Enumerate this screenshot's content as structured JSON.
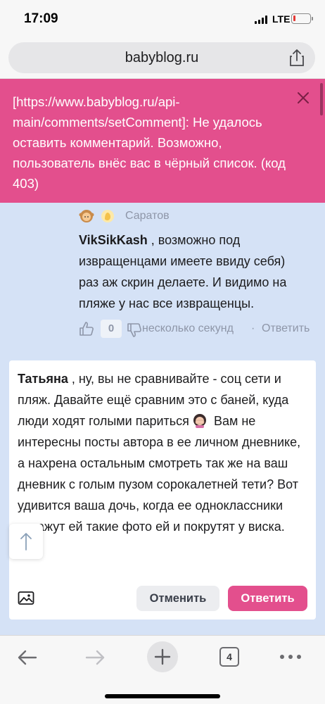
{
  "status_bar": {
    "time": "17:09",
    "network": "LTE",
    "battery_level": 0.15,
    "battery_color": "#e53935"
  },
  "browser": {
    "url": "babyblog.ru",
    "tab_count": "4"
  },
  "error_toast": {
    "message": "[https://www.babyblog.ru/api-main/comments/setComment]: Не удалось оставить комментарий. Возможно, пользователь внёс вас в чёрный список. (код 403)",
    "color": "#e34f8d"
  },
  "comment": {
    "city": "Саратов",
    "reply_to": "VikSikKash",
    "text": " , возможно под извращенцами имеете ввиду себя) раз аж скрин делаете. И видимо на пляже у нас все извращенцы.",
    "likes": "0",
    "time": "несколько секунд",
    "separator": "·",
    "reply_label": "Ответить"
  },
  "reply_form": {
    "reply_to": "Татьяна",
    "text_part1": " , ну, вы не сравнивайте - соц сети и пляж. Давайте ещё сравним это с баней, куда люди ходят голыми париться",
    "text_part2": " Вам не интересны посты автора в ее личном дневнике, а нахрена остальным смотреть так же на ваш дневник с голым пузом сорокалетней тети? Вот удивится ваша дочь, когда ее одноклассники покажут ей такие фото ей и покрутят у виска.",
    "cancel_label": "Отменить",
    "submit_label": "Ответить"
  }
}
